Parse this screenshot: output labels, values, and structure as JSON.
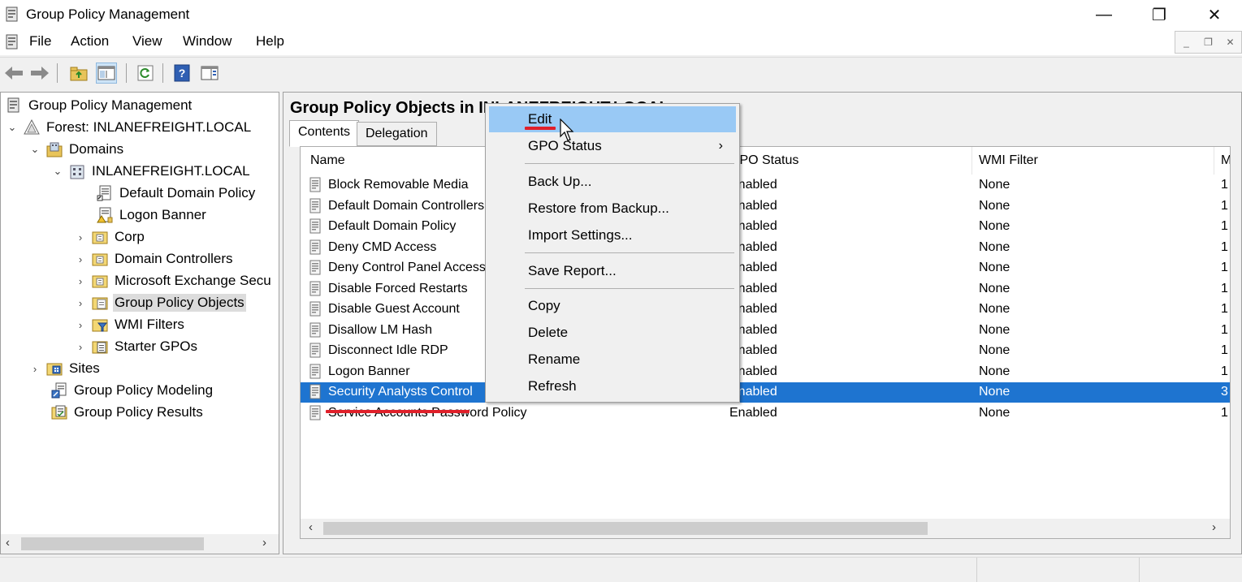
{
  "window": {
    "title": "Group Policy Management",
    "controls": {
      "minimize": "—",
      "restore": "❐",
      "close": "✕"
    }
  },
  "menu": [
    "File",
    "Action",
    "View",
    "Window",
    "Help"
  ],
  "tree": {
    "items": [
      {
        "label": "Group Policy Management",
        "icon": "gpm-icon"
      },
      {
        "label": "Forest: INLANEFREIGHT.LOCAL",
        "icon": "forest-icon",
        "expanded": true
      },
      {
        "label": "Domains",
        "icon": "domains-icon",
        "expanded": true
      },
      {
        "label": "INLANEFREIGHT.LOCAL",
        "icon": "domain-icon",
        "expanded": true
      },
      {
        "label": "Default Domain Policy",
        "icon": "gpo-link-icon"
      },
      {
        "label": "Logon Banner",
        "icon": "gpo-link-icon"
      },
      {
        "label": "Corp",
        "icon": "ou-folder-icon"
      },
      {
        "label": "Domain Controllers",
        "icon": "ou-folder-icon"
      },
      {
        "label": "Microsoft Exchange Secu",
        "icon": "ou-folder-icon"
      },
      {
        "label": "Group Policy Objects",
        "icon": "gpo-folder-icon",
        "selected": true
      },
      {
        "label": "WMI Filters",
        "icon": "wmi-folder-icon"
      },
      {
        "label": "Starter GPOs",
        "icon": "starter-folder-icon"
      },
      {
        "label": "Sites",
        "icon": "sites-icon"
      },
      {
        "label": "Group Policy Modeling",
        "icon": "modeling-icon"
      },
      {
        "label": "Group Policy Results",
        "icon": "results-icon"
      }
    ]
  },
  "content": {
    "title": "Group Policy Objects in INLANEFREIGHT.LOCAL",
    "tabs": [
      "Contents",
      "Delegation"
    ],
    "columns": [
      "Name",
      "GPO Status",
      "WMI Filter",
      "M"
    ],
    "rows": [
      {
        "name": "Block Removable Media",
        "status": "Enabled",
        "wmi": "None",
        "mod": "1"
      },
      {
        "name": "Default Domain Controllers",
        "status": "Enabled",
        "wmi": "None",
        "mod": "1"
      },
      {
        "name": "Default Domain Policy",
        "status": "Enabled",
        "wmi": "None",
        "mod": "1"
      },
      {
        "name": "Deny CMD Access",
        "status": "Enabled",
        "wmi": "None",
        "mod": "1"
      },
      {
        "name": "Deny Control Panel Access",
        "status": "Enabled",
        "wmi": "None",
        "mod": "1"
      },
      {
        "name": "Disable Forced Restarts",
        "status": "Enabled",
        "wmi": "None",
        "mod": "1"
      },
      {
        "name": "Disable Guest Account",
        "status": "Enabled",
        "wmi": "None",
        "mod": "1"
      },
      {
        "name": "Disallow LM Hash",
        "status": "Enabled",
        "wmi": "None",
        "mod": "1"
      },
      {
        "name": "Disconnect Idle RDP",
        "status": "Enabled",
        "wmi": "None",
        "mod": "1"
      },
      {
        "name": "Logon Banner",
        "status": "Enabled",
        "wmi": "None",
        "mod": "1"
      },
      {
        "name": "Security Analysts Control",
        "status": "Enabled",
        "wmi": "None",
        "mod": "3",
        "selected": true
      },
      {
        "name": "Service Accounts Password Policy",
        "status": "Enabled",
        "wmi": "None",
        "mod": "1"
      }
    ]
  },
  "context_menu": {
    "items": [
      {
        "label": "Edit",
        "highlighted": true
      },
      {
        "label": "GPO Status",
        "submenu": "›"
      },
      {
        "label": "Back Up..."
      },
      {
        "label": "Restore from Backup..."
      },
      {
        "label": "Import Settings..."
      },
      {
        "label": "Save Report..."
      },
      {
        "label": "Copy"
      },
      {
        "label": "Delete"
      },
      {
        "label": "Rename"
      },
      {
        "label": "Refresh"
      }
    ]
  },
  "colors": {
    "selection": "#1e74d0",
    "menu_highlight": "#99c9f5",
    "annotation": "#e0202a"
  }
}
